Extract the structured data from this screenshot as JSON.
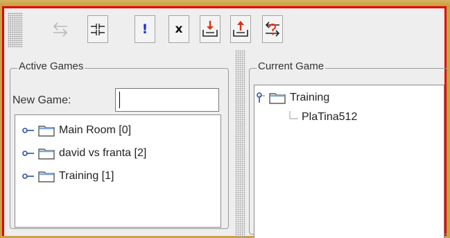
{
  "toolbar": {
    "buttons": [
      {
        "name": "swap",
        "icon": "swap-arrows-icon",
        "enabled": false
      },
      {
        "name": "split",
        "icon": "split-icon",
        "enabled": true
      },
      {
        "name": "alert",
        "icon": "exclamation-icon",
        "text": "!",
        "enabled": true
      },
      {
        "name": "close",
        "icon": "close-x-icon",
        "text": "x",
        "enabled": true
      },
      {
        "name": "download",
        "icon": "download-tray-icon",
        "enabled": true
      },
      {
        "name": "upload",
        "icon": "upload-tray-icon",
        "enabled": true
      },
      {
        "name": "exchange",
        "icon": "question-exchange-icon",
        "enabled": true
      }
    ]
  },
  "active_games": {
    "legend": "Active Games",
    "new_game_label": "New Game:",
    "new_game_value": "",
    "games": [
      {
        "label": "Main Room [0]"
      },
      {
        "label": "david vs franta [2]"
      },
      {
        "label": "Training [1]"
      }
    ]
  },
  "current_game": {
    "legend": "Current Game",
    "root": "Training",
    "players": [
      "PlaTina512"
    ]
  },
  "colors": {
    "frame_border": "#e60000",
    "panel_bg": "#eeeeee",
    "outer_bg": "#c9a24a"
  }
}
